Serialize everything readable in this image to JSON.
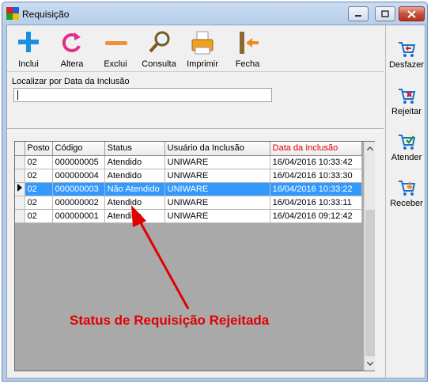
{
  "window": {
    "title": "Requisição"
  },
  "toolbar": {
    "buttons": [
      {
        "label": "Inclui",
        "icon": "plus-icon"
      },
      {
        "label": "Altera",
        "icon": "refresh-icon"
      },
      {
        "label": "Exclui",
        "icon": "minus-icon"
      },
      {
        "label": "Consulta",
        "icon": "magnifier-icon"
      },
      {
        "label": "Imprimir",
        "icon": "printer-icon"
      },
      {
        "label": "Fecha",
        "icon": "door-exit-icon"
      }
    ]
  },
  "search": {
    "label": "Localizar por Data da Inclusão",
    "value": ""
  },
  "grid": {
    "columns": [
      "Posto",
      "Código",
      "Status",
      "Usuário da Inclusão",
      "Data da Inclusão"
    ],
    "rows": [
      {
        "posto": "02",
        "codigo": "000000005",
        "status": "Atendido",
        "usuario": "UNIWARE",
        "data": "16/04/2016 10:33:42"
      },
      {
        "posto": "02",
        "codigo": "000000004",
        "status": "Atendido",
        "usuario": "UNIWARE",
        "data": "16/04/2016 10:33:30"
      },
      {
        "posto": "02",
        "codigo": "000000003",
        "status": "Não Atendido",
        "usuario": "UNIWARE",
        "data": "16/04/2016 10:33:22"
      },
      {
        "posto": "02",
        "codigo": "000000002",
        "status": "Atendido",
        "usuario": "UNIWARE",
        "data": "16/04/2016 10:33:11"
      },
      {
        "posto": "02",
        "codigo": "000000001",
        "status": "Atendido",
        "usuario": "UNIWARE",
        "data": "16/04/2016 09:12:42"
      }
    ],
    "selected_row": 2
  },
  "sidebar": {
    "buttons": [
      {
        "label": "Desfazer",
        "icon": "cart-undo-icon"
      },
      {
        "label": "Rejeitar",
        "icon": "cart-reject-icon"
      },
      {
        "label": "Atender",
        "icon": "cart-check-icon"
      },
      {
        "label": "Receber",
        "icon": "cart-receive-icon"
      }
    ]
  },
  "annotation": {
    "text": "Status de Requisição Rejeitada"
  },
  "colors": {
    "selection": "#3399ff",
    "date_header": "#e00000",
    "annotation": "#e10000"
  }
}
